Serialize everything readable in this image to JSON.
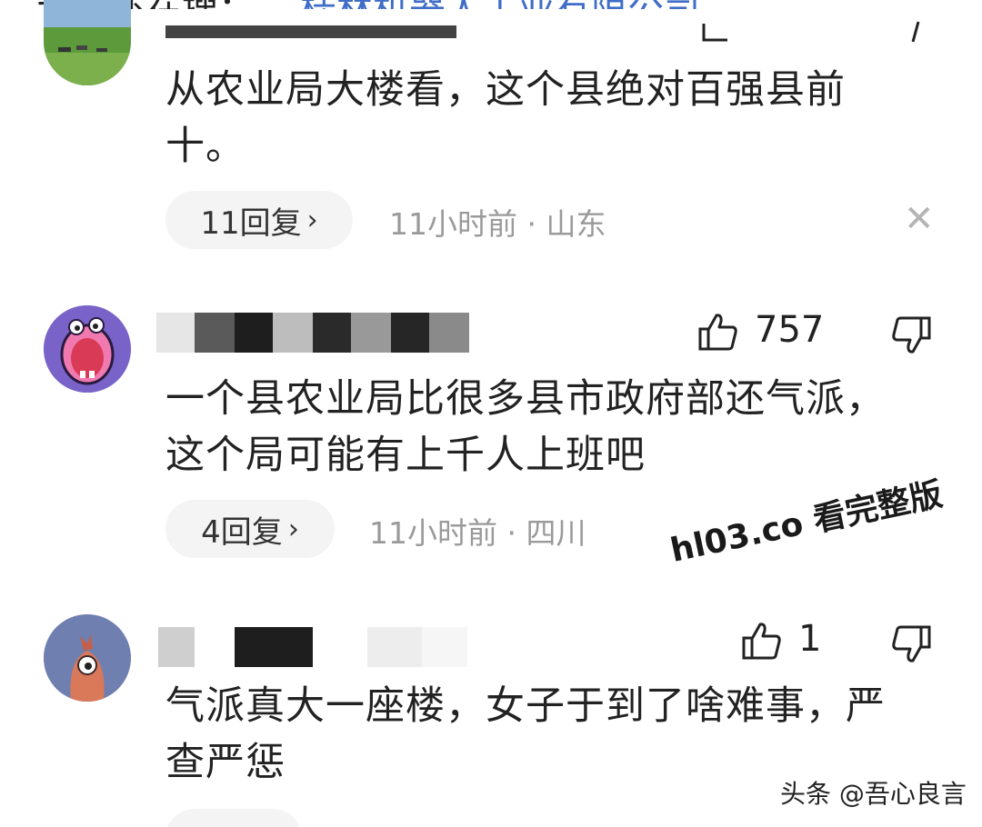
{
  "top_strip": {
    "text": "大家还在搜：",
    "link": "桂林机器人工业有限公司"
  },
  "comments": [
    {
      "text": "从农业局大楼看，这个县绝对百强县前十。",
      "replies": "11回复",
      "time": "11小时前",
      "location": "山东",
      "avatar": "landscape-avatar"
    },
    {
      "text": "一个县农业局比很多县市政府部还气派，这个局可能有上千人上班吧",
      "likes": "757",
      "replies": "4回复",
      "time": "11小时前",
      "location": "四川",
      "avatar": "screaming-face-avatar"
    },
    {
      "text": "气派真大一座楼，女子于到了啥难事，严查严惩",
      "likes": "1",
      "avatar": "bird-avatar"
    }
  ],
  "separator": "·",
  "watermark": "hl03.co 看完整版",
  "source": "头条 @吾心良言",
  "icons": {
    "like": "thumbs-up-icon",
    "dislike": "thumbs-down-icon",
    "close": "close-icon",
    "chevron": "chevron-right-icon"
  },
  "colors": {
    "text": "#222222",
    "meta": "#9a9a9a",
    "pill": "#f4f4f4",
    "link": "#3f6dc7"
  }
}
